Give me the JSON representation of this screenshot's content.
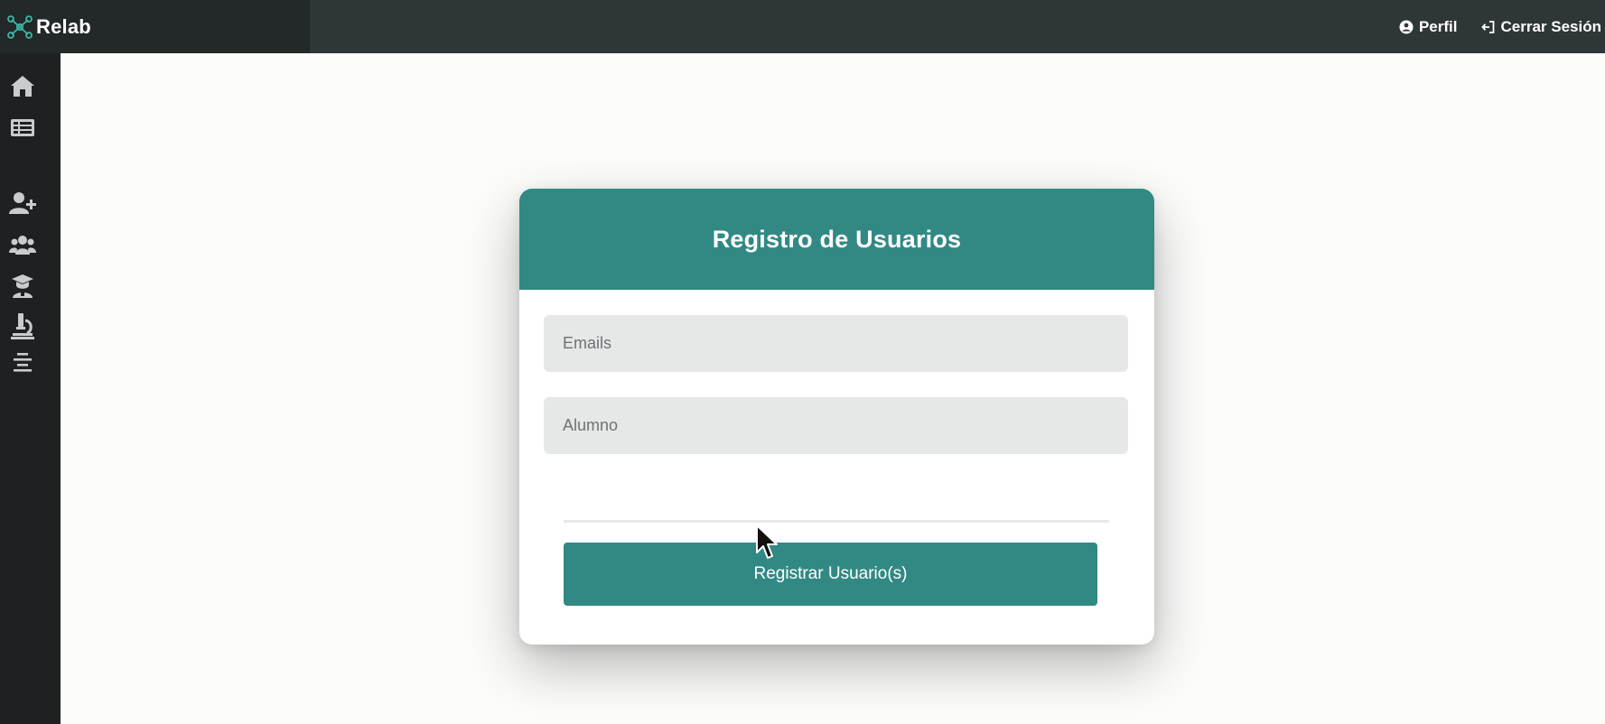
{
  "app": {
    "brand_name": "Relab"
  },
  "topnav": {
    "profile_label": "Perfil",
    "logout_label": "Cerrar Sesión"
  },
  "sidebar": {
    "items": [
      {
        "icon": "home-icon"
      },
      {
        "icon": "list-icon"
      },
      {
        "icon": "user-plus-icon"
      },
      {
        "icon": "users-icon"
      },
      {
        "icon": "graduate-icon"
      },
      {
        "icon": "microscope-icon"
      },
      {
        "icon": "align-center-icon"
      }
    ]
  },
  "form": {
    "title": "Registro de Usuarios",
    "emails_placeholder": "Emails",
    "emails_value": "",
    "role_placeholder": "Alumno",
    "role_value": "",
    "submit_label": "Registrar Usuario(s)"
  },
  "colors": {
    "accent": "#328984",
    "topbar": "#2f3638",
    "sidebar": "#1e2122",
    "input_bg": "#e6e8e8"
  }
}
